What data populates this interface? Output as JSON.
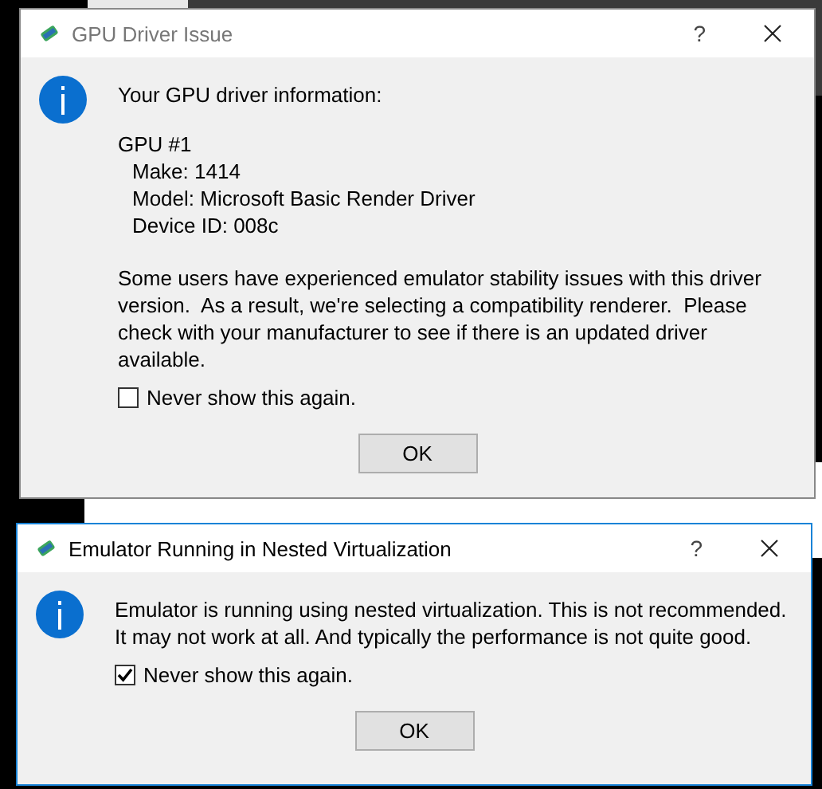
{
  "dialogs": [
    {
      "title": "GPU Driver Issue",
      "focused": false,
      "intro": "Your GPU driver information:",
      "details": [
        {
          "heading": "GPU #1",
          "children": [
            "Make: 1414",
            "Model: Microsoft Basic Render Driver",
            "Device ID: 008c"
          ]
        }
      ],
      "message": "Some users have experienced emulator stability issues with this driver version.  As a result, we're selecting a compatibility renderer.  Please check with your manufacturer to see if there is an updated driver available.",
      "help": "?",
      "checkbox": {
        "label": "Never show this again.",
        "checked": false
      },
      "button": "OK"
    },
    {
      "title": "Emulator Running in Nested Virtualization",
      "focused": true,
      "message": "Emulator is running using nested virtualization. This is not recommended. It may not work at all. And typically the performance is not quite good.",
      "help": "?",
      "checkbox": {
        "label": "Never show this again.",
        "checked": true
      },
      "button": "OK"
    }
  ]
}
